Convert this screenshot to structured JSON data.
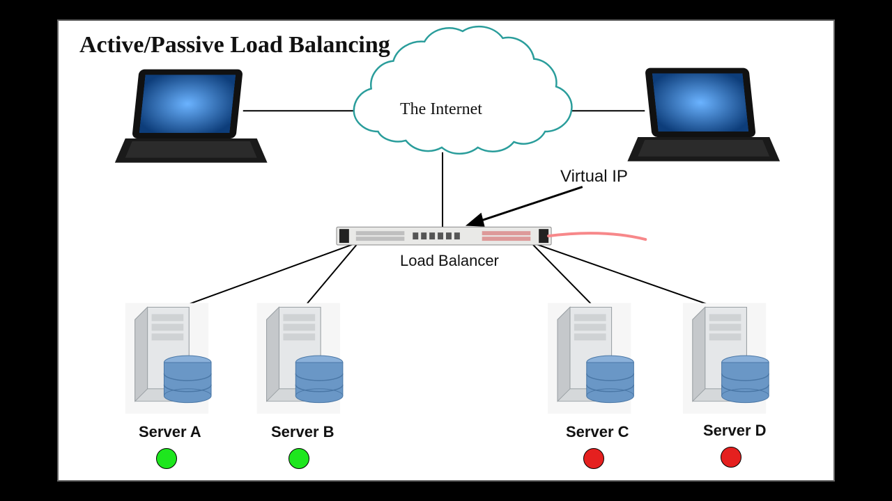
{
  "title": "Active/Passive Load Balancing",
  "cloud_label": "The Internet",
  "virtual_ip_label": "Virtual IP",
  "load_balancer_label": "Load Balancer",
  "servers": [
    {
      "name": "Server A",
      "status": "active",
      "status_color": "#1ee61e"
    },
    {
      "name": "Server B",
      "status": "active",
      "status_color": "#1ee61e"
    },
    {
      "name": "Server C",
      "status": "passive",
      "status_color": "#e5201f"
    },
    {
      "name": "Server D",
      "status": "passive",
      "status_color": "#e5201f"
    }
  ],
  "colors": {
    "cloud_stroke": "#2a9d9b",
    "desktop_blue": "#1f6fd6",
    "antenna": "#f7888a",
    "db_blue": "#6a97c6",
    "db_blue_dark": "#4a77a6",
    "server_gray": "#d5d8da",
    "server_gray_dark": "#b8bcbe"
  }
}
